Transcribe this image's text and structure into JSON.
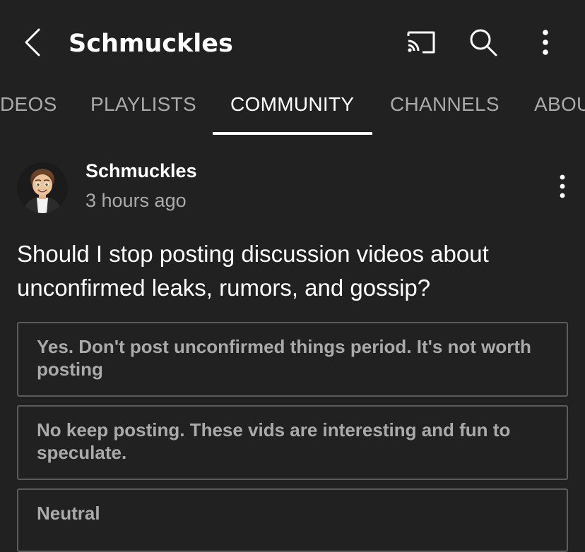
{
  "header": {
    "title": "Schmuckles",
    "back_icon": "back-arrow-icon",
    "cast_icon": "cast-icon",
    "search_icon": "search-icon",
    "more_icon": "more-vertical-icon"
  },
  "tabs": [
    {
      "label": "DEOS",
      "active": false
    },
    {
      "label": "PLAYLISTS",
      "active": false
    },
    {
      "label": "COMMUNITY",
      "active": true
    },
    {
      "label": "CHANNELS",
      "active": false
    },
    {
      "label": "ABOU",
      "active": false
    }
  ],
  "post": {
    "author": "Schmuckles",
    "time": "3 hours ago",
    "question": "Should I stop posting discussion videos about unconfirmed leaks, rumors, and gossip?",
    "poll_options": [
      "Yes. Don't post unconfirmed things period. It's not worth posting",
      "No keep posting. These vids are interesting and fun to speculate.",
      "Neutral"
    ]
  },
  "colors": {
    "background": "#212121",
    "primary_text": "#ffffff",
    "secondary_text": "#aaaaaa",
    "option_border": "#5c5c5c"
  }
}
